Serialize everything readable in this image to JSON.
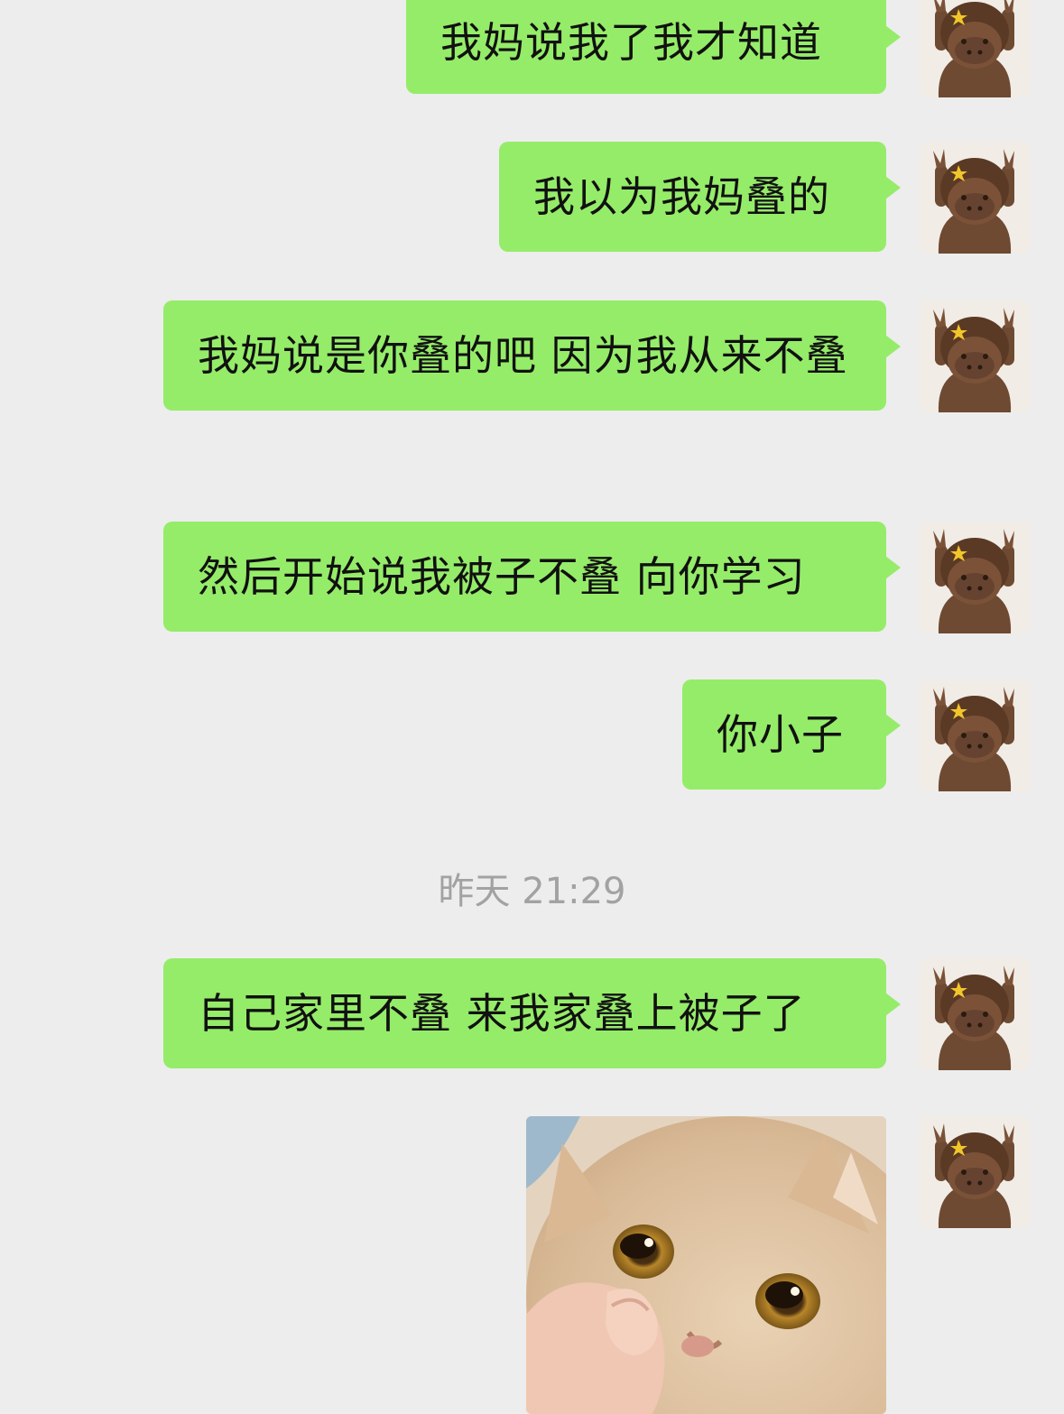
{
  "messages": [
    {
      "text": "我妈说我了我才知道"
    },
    {
      "text": "我以为我妈叠的"
    },
    {
      "text": "我妈说是你叠的吧 因为我从来不叠"
    },
    {
      "text": "然后开始说我被子不叠 向你学习"
    },
    {
      "text": "你小子"
    },
    {
      "text": "自己家里不叠 来我家叠上被子了"
    }
  ],
  "timestamp": "昨天 21:29",
  "image_message": {
    "description": "cat-thumbs-up-sticker"
  },
  "colors": {
    "background": "#ededed",
    "bubble": "#95ec69",
    "timestamp": "#a2a2a2"
  }
}
